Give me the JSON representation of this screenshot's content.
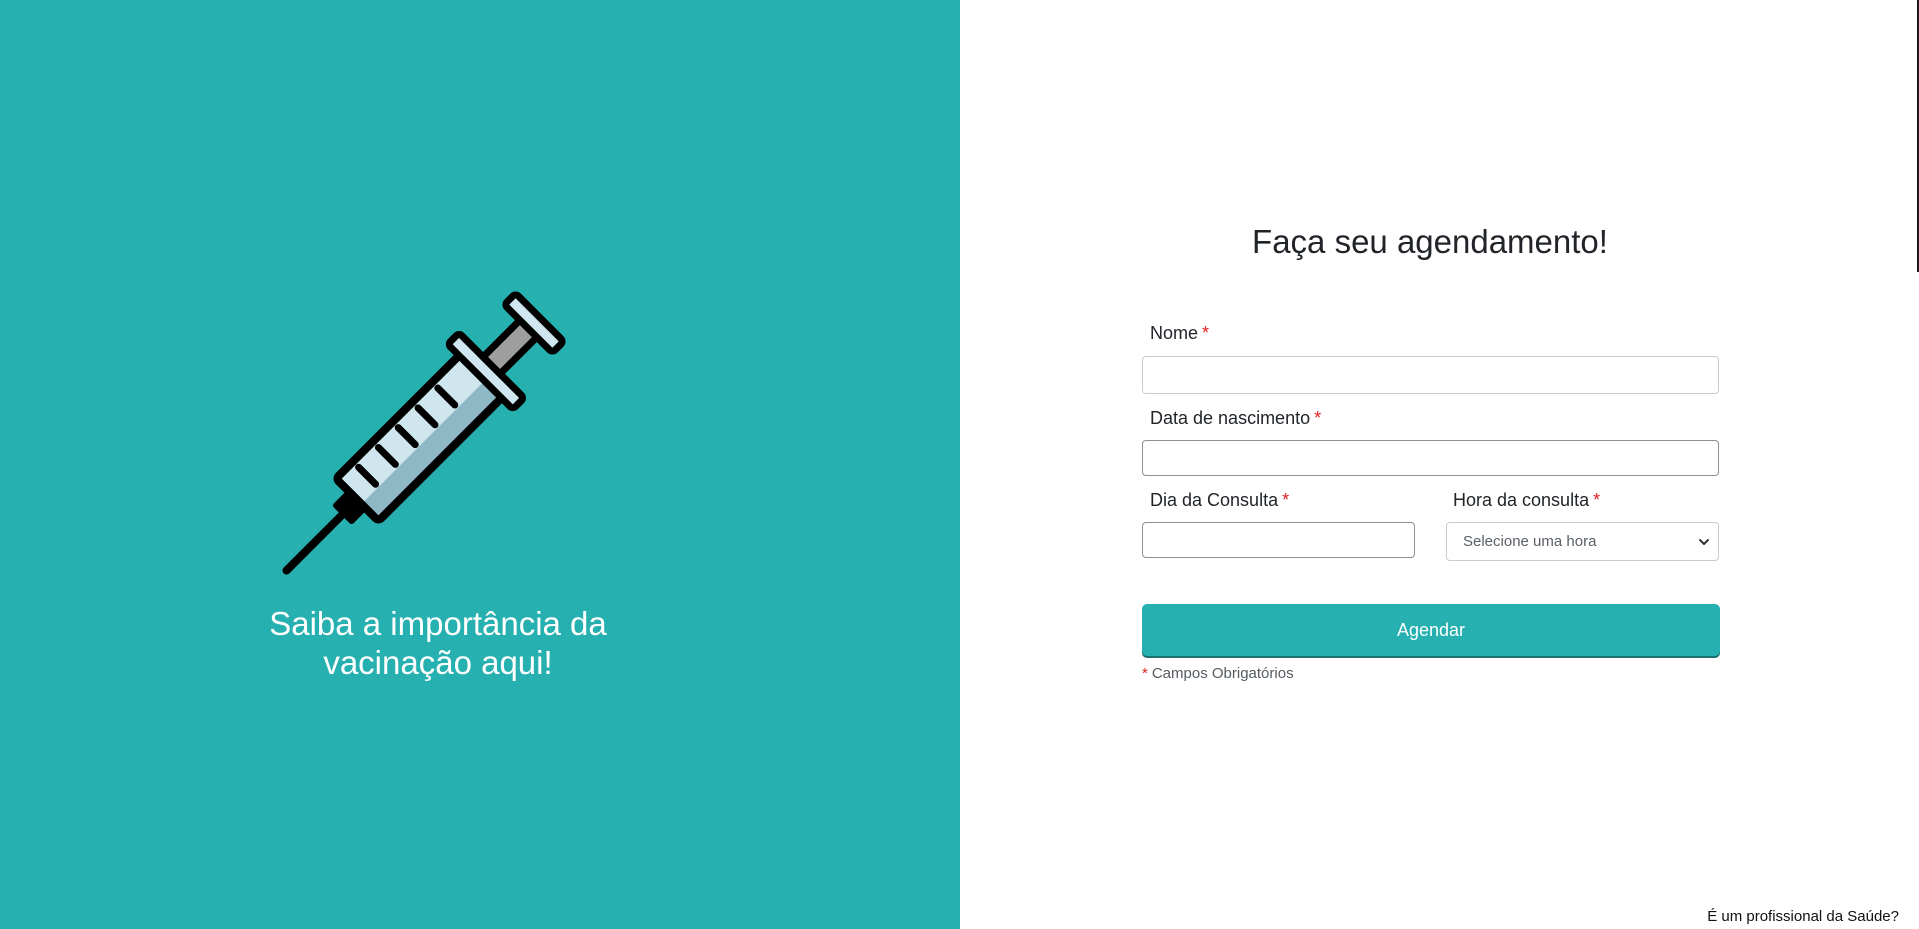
{
  "left_panel": {
    "background_color": "#26b0b0",
    "illustration": "syringe-icon",
    "link_line1": "Saiba a importância da",
    "link_line2": "vacinação aqui!"
  },
  "form": {
    "title": "Faça seu agendamento!",
    "required_marker": "*",
    "fields": {
      "name": {
        "label": "Nome",
        "value": ""
      },
      "birth_date": {
        "label": "Data de nascimento",
        "value": ""
      },
      "consult_day": {
        "label": "Dia da Consulta",
        "value": ""
      },
      "consult_hour": {
        "label": "Hora da consulta",
        "selected": "Selecione uma hora"
      }
    },
    "submit_label": "Agendar",
    "required_note": "Campos Obrigatórios"
  },
  "footer": {
    "professional_link": "É um profissional da Saúde?"
  },
  "colors": {
    "accent": "#26b0b0",
    "required": "#e01e1e"
  }
}
